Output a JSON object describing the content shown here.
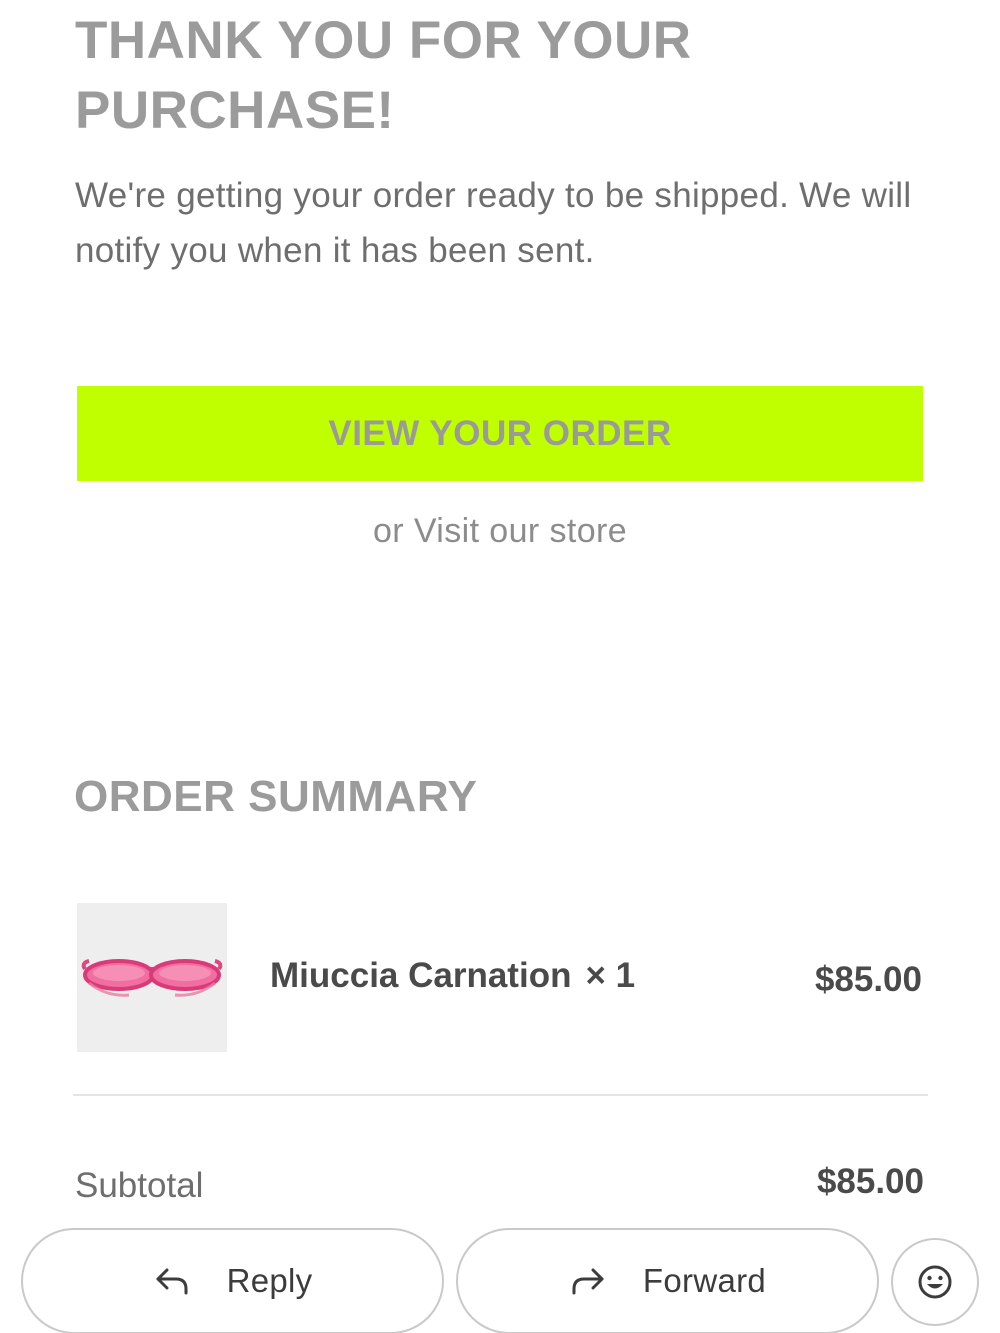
{
  "email": {
    "headline": "THANK YOU FOR YOUR PURCHASE!",
    "message": "We're getting your order ready to be shipped. We will notify you when it has been sent.",
    "cta": {
      "label": "VIEW YOUR ORDER",
      "color": "#bfff00"
    },
    "visit_store_link": "or Visit our store"
  },
  "order_summary": {
    "title": "ORDER SUMMARY",
    "items": [
      {
        "name": "Miuccia Carnation",
        "quantity": "× 1",
        "price": "$85.00",
        "image_icon": "pink-sunglasses-product-image"
      }
    ],
    "subtotal_label": "Subtotal",
    "subtotal_value": "$85.00"
  },
  "action_bar": {
    "reply_label": "Reply",
    "reply_icon": "reply-arrow-icon",
    "forward_label": "Forward",
    "forward_icon": "forward-arrow-icon",
    "emoji_icon": "smiley-face-icon"
  }
}
